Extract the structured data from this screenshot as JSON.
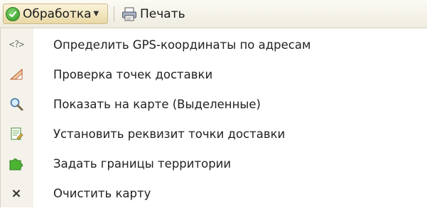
{
  "toolbar": {
    "process_label": "Обработка",
    "print_label": "Печать",
    "icons": {
      "process": "ok-check-icon",
      "print": "printer-icon"
    }
  },
  "menu": {
    "items": [
      {
        "label": "Определить GPS-координаты по адресам",
        "icon": "gps-code-icon",
        "icon_text": "<?>"
      },
      {
        "label": "Проверка точек доставки",
        "icon": "triangle-ruler-icon"
      },
      {
        "label": "Показать на карте (Выделенные)",
        "icon": "magnifier-icon"
      },
      {
        "label": "Установить реквизит точки доставки",
        "icon": "document-edit-icon"
      },
      {
        "label": "Задать границы территории",
        "icon": "puzzle-icon"
      },
      {
        "label": "Очистить карту",
        "icon": "clear-icon",
        "icon_text": "×"
      }
    ]
  },
  "colors": {
    "toolbar_bg": "#efece0",
    "button_active_bg": "#ead9a6",
    "gutter_bg": "#f4f2ea",
    "ok_green": "#2f9a28"
  }
}
